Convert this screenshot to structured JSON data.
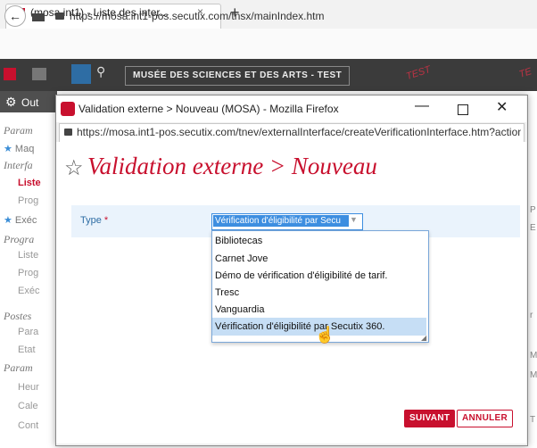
{
  "browser": {
    "tab_title": "(mosa.int1) - Liste des inter...",
    "tab_close": "×",
    "new_tab": "+",
    "back": "←",
    "url": "https://mosa.int1-pos.secutix.com/tnsx/mainIndex.htm"
  },
  "app_header": {
    "title": "MUSÉE DES SCIENCES ET DES ARTS - TEST",
    "search_icon": "⚲",
    "watermark": "TEST",
    "watermark_cut": "TE"
  },
  "sidebar": {
    "gear_icon": "⚙",
    "header_label": "Out",
    "items": [
      {
        "text": "Param",
        "kind": "cat"
      },
      {
        "text": "Maq",
        "kind": "star"
      },
      {
        "text": "Interfa",
        "kind": "cat"
      },
      {
        "text": "Liste",
        "kind": "active"
      },
      {
        "text": "Prog",
        "kind": "sub"
      },
      {
        "text": "Exéc",
        "kind": "star"
      },
      {
        "text": "Progra",
        "kind": "cat"
      },
      {
        "text": "Liste",
        "kind": "sub"
      },
      {
        "text": "Prog",
        "kind": "sub"
      },
      {
        "text": "Exéc",
        "kind": "sub"
      },
      {
        "text": "Postes",
        "kind": "cat"
      },
      {
        "text": "Para",
        "kind": "sub"
      },
      {
        "text": "Etat",
        "kind": "sub"
      },
      {
        "text": "Param",
        "kind": "cat"
      },
      {
        "text": "Heur",
        "kind": "sub"
      },
      {
        "text": "Cale",
        "kind": "sub"
      },
      {
        "text": "Cont",
        "kind": "sub"
      }
    ]
  },
  "right_side": [
    "P",
    "E",
    "r",
    "M",
    "M",
    "T"
  ],
  "popup": {
    "window_title": "Validation externe > Nouveau (MOSA) - Mozilla Firefox",
    "minimize": "—",
    "close": "✕",
    "url": "https://mosa.int1-pos.secutix.com/tnev/externalInterface/createVerificationInterface.htm?action",
    "page_star": "☆",
    "page_title": "Validation externe > Nouveau",
    "form": {
      "type_label": "Type",
      "required_mark": "*",
      "selected_value": "Vérification d'éligibilité par Secu",
      "select_arrow": "▼",
      "options": [
        "Bibliotecas",
        "Carnet Jove",
        "Démo de vérification d'éligibilité de tarif.",
        "Tresc",
        "Vanguardia",
        "Vérification d'éligibilité par Secutix 360."
      ],
      "highlighted_index": 5
    },
    "buttons": {
      "next": "SUIVANT",
      "cancel": "ANNULER"
    }
  },
  "colors": {
    "brand_red": "#c8102e",
    "select_blue": "#3d8ee0",
    "highlight": "#c6def5"
  }
}
